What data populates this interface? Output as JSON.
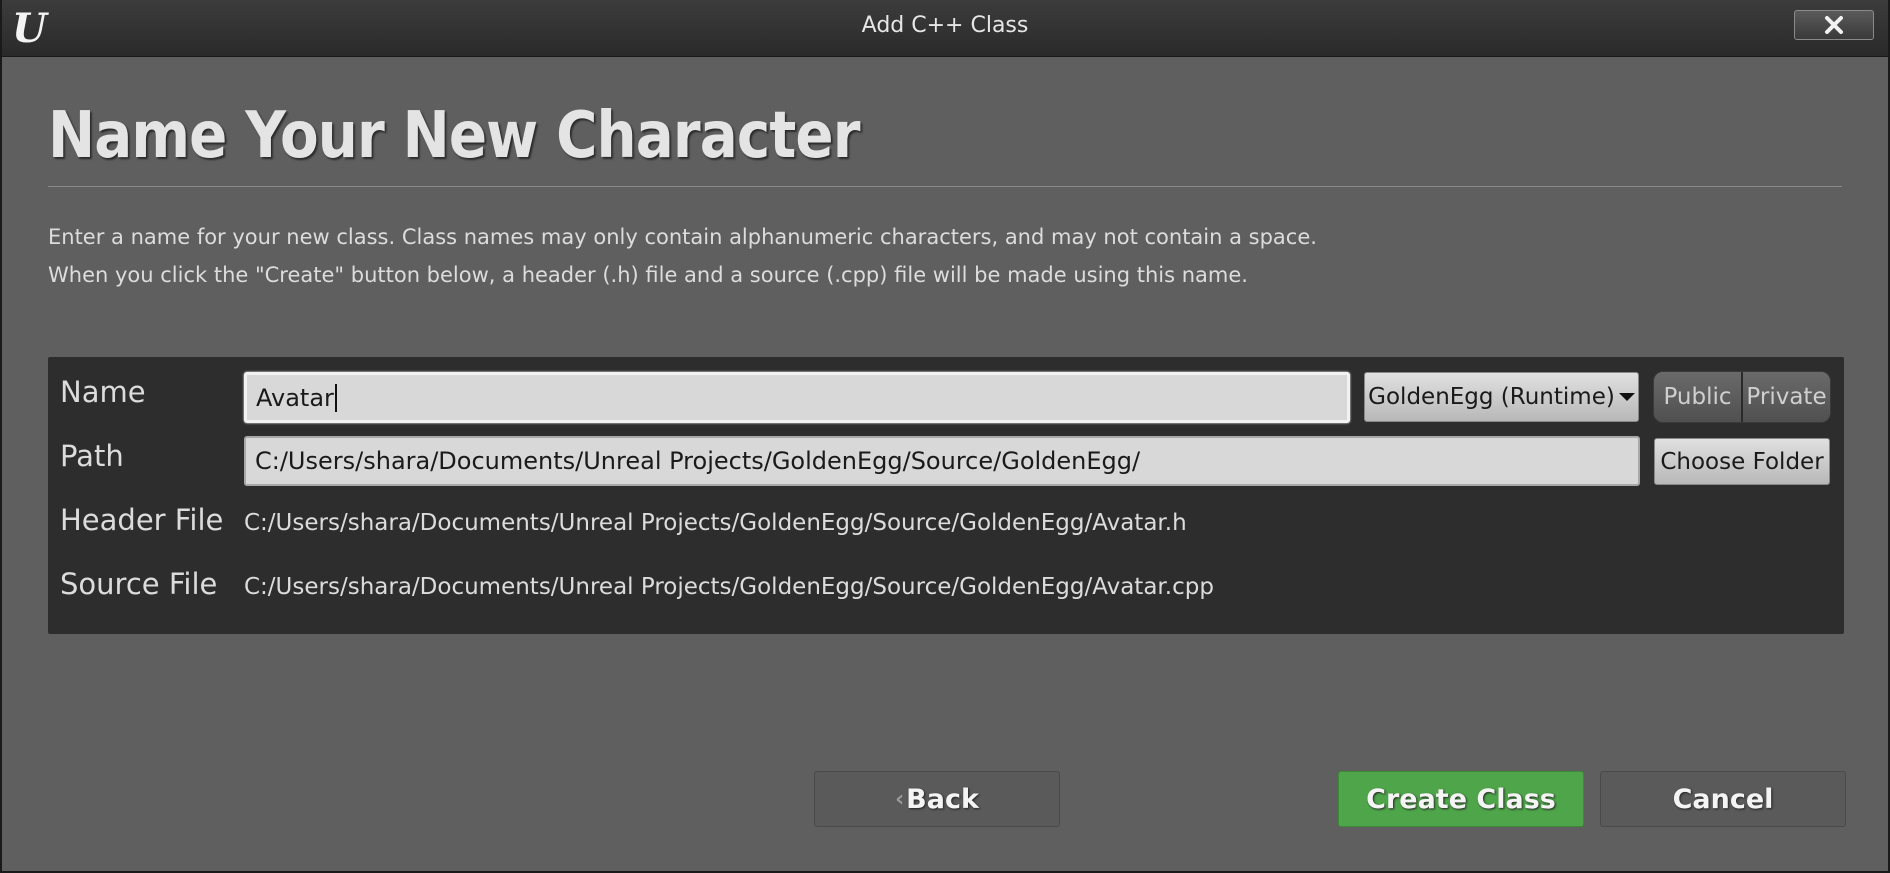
{
  "window": {
    "title": "Add C++ Class",
    "logo_icon": "unreal-logo-icon",
    "close_icon": "close-icon"
  },
  "heading": "Name Your New Character",
  "description": {
    "line1": "Enter a name for your new class. Class names may only contain alphanumeric characters, and may not contain a space.",
    "line2": "When you click the \"Create\" button below, a header (.h) file and a source (.cpp) file will be made using this name."
  },
  "form": {
    "name_label": "Name",
    "name_value": "Avatar",
    "module_select": "GoldenEgg (Runtime)",
    "public_label": "Public",
    "private_label": "Private",
    "path_label": "Path",
    "path_value": "C:/Users/shara/Documents/Unreal Projects/GoldenEgg/Source/GoldenEgg/",
    "choose_folder_label": "Choose Folder",
    "header_label": "Header File",
    "header_value": "C:/Users/shara/Documents/Unreal Projects/GoldenEgg/Source/GoldenEgg/Avatar.h",
    "source_label": "Source File",
    "source_value": "C:/Users/shara/Documents/Unreal Projects/GoldenEgg/Source/GoldenEgg/Avatar.cpp"
  },
  "footer": {
    "back_label": "Back",
    "create_label": "Create Class",
    "cancel_label": "Cancel"
  },
  "colors": {
    "background": "#5f5f5f",
    "panel": "#2d2d2d",
    "create_button": "#4fa64a"
  }
}
